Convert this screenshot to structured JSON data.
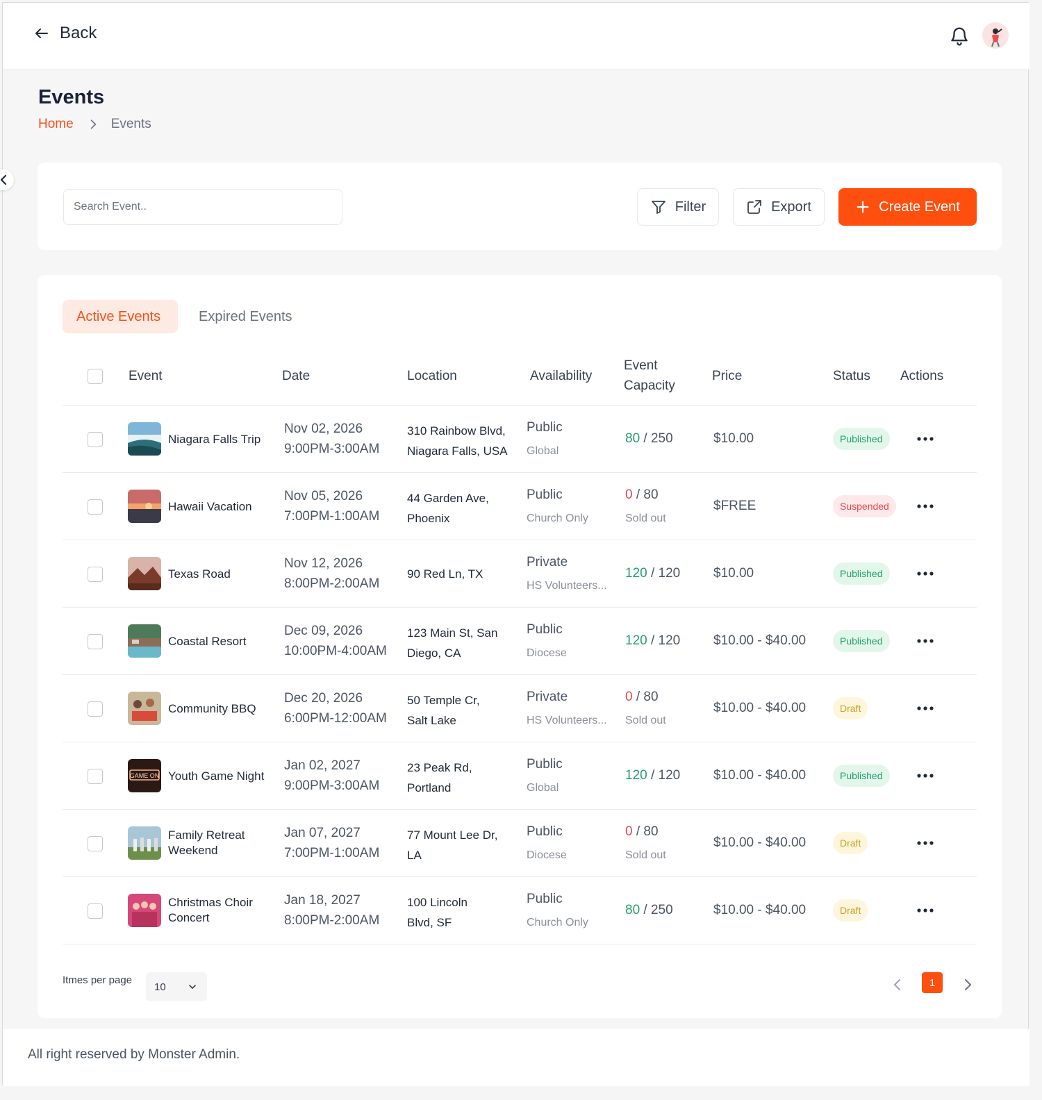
{
  "header": {
    "back_label": "Back"
  },
  "page": {
    "title": "Events",
    "breadcrumb_home": "Home",
    "breadcrumb_current": "Events"
  },
  "toolbar": {
    "search_placeholder": "Search Event..",
    "filter_label": "Filter",
    "export_label": "Export",
    "create_label": "Create Event"
  },
  "tabs": {
    "active": "Active Events",
    "expired": "Expired Events"
  },
  "table": {
    "columns": {
      "event": "Event",
      "date": "Date",
      "location": "Location",
      "availability": "Availability",
      "capacity": "Event Capacity",
      "price": "Price",
      "status": "Status",
      "actions": "Actions"
    },
    "rows": [
      {
        "name": "Niagara Falls Trip",
        "date": "Nov 02, 2026",
        "time": "9:00PM-3:00AM",
        "loc1": "310 Rainbow Blvd,",
        "loc2": "Niagara Falls, USA",
        "avail": "Public",
        "avail_sub": "Global",
        "booked": "80",
        "capacity": "/ 250",
        "cap_note": "",
        "price": "$10.00",
        "status": "Published"
      },
      {
        "name": "Hawaii Vacation",
        "date": "Nov 05, 2026",
        "time": "7:00PM-1:00AM",
        "loc1": "44 Garden Ave,",
        "loc2": "Phoenix",
        "avail": "Public",
        "avail_sub": "Church Only",
        "booked": "0",
        "capacity": "/ 80",
        "cap_note": "Sold out",
        "price": "$FREE",
        "status": "Suspended"
      },
      {
        "name": "Texas Road",
        "date": "Nov 12, 2026",
        "time": "8:00PM-2:00AM",
        "loc1": "90 Red Ln, TX",
        "loc2": "",
        "avail": "Private",
        "avail_sub": "HS Volunteers...",
        "booked": "120",
        "capacity": "/ 120",
        "cap_note": "",
        "price": "$10.00",
        "status": "Published"
      },
      {
        "name": "Coastal Resort",
        "date": "Dec 09, 2026",
        "time": "10:00PM-4:00AM",
        "loc1": "123 Main St, San",
        "loc2": "Diego, CA",
        "avail": "Public",
        "avail_sub": "Diocese",
        "booked": "120",
        "capacity": "/ 120",
        "cap_note": "",
        "price": "$10.00 - $40.00",
        "status": "Published"
      },
      {
        "name": "Community BBQ",
        "date": "Dec 20, 2026",
        "time": "6:00PM-12:00AM",
        "loc1": "50 Temple Cr,",
        "loc2": "Salt Lake",
        "avail": "Private",
        "avail_sub": "HS Volunteers...",
        "booked": "0",
        "capacity": "/ 80",
        "cap_note": "Sold out",
        "price": "$10.00 - $40.00",
        "status": "Draft"
      },
      {
        "name": "Youth Game Night",
        "date": "Jan 02, 2027",
        "time": "9:00PM-3:00AM",
        "loc1": "23 Peak Rd,",
        "loc2": "Portland",
        "avail": "Public",
        "avail_sub": "Global",
        "booked": "120",
        "capacity": "/ 120",
        "cap_note": "",
        "price": "$10.00 - $40.00",
        "status": "Published"
      },
      {
        "name": "Family Retreat Weekend",
        "date": "Jan 07, 2027",
        "time": "7:00PM-1:00AM",
        "loc1": "77 Mount Lee Dr,",
        "loc2": "LA",
        "avail": "Public",
        "avail_sub": "Diocese",
        "booked": "0",
        "capacity": "/ 80",
        "cap_note": "Sold out",
        "price": "$10.00 - $40.00",
        "status": "Draft"
      },
      {
        "name": "Christmas Choir Concert",
        "date": "Jan 18, 2027",
        "time": "8:00PM-2:00AM",
        "loc1": "100 Lincoln",
        "loc2": "Blvd, SF",
        "avail": "Public",
        "avail_sub": "Church Only",
        "booked": "80",
        "capacity": "/ 250",
        "cap_note": "",
        "price": "$10.00 - $40.00",
        "status": "Draft"
      }
    ]
  },
  "thumb_text": {
    "youth": "GAME ON"
  },
  "pagination": {
    "per_page_label": "Itmes per page",
    "per_page_value": "10",
    "current_page": "1"
  },
  "footer": {
    "text": "All right reserved by Monster Admin."
  },
  "colors": {
    "accent": "#fe4f0f",
    "success": "#22a06b",
    "danger": "#e5484d",
    "warning": "#c9a227"
  },
  "icons": [
    "arrow-left-icon",
    "bell-icon",
    "filter-icon",
    "export-icon",
    "plus-icon",
    "chevron-right-icon",
    "chevron-left-icon",
    "chevron-down-icon",
    "more-dots-icon"
  ]
}
